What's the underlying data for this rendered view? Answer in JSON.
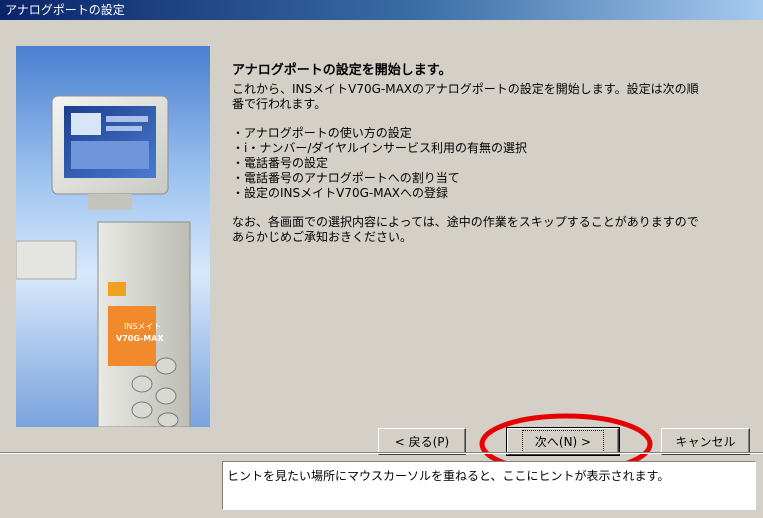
{
  "window": {
    "title": "アナログポートの設定"
  },
  "main": {
    "heading": "アナログポートの設定を開始します。",
    "intro_line1": "これから、INSメイトV70G-MAXのアナログポートの設定を開始します。設定は次の順",
    "intro_line2": "番で行われます。",
    "steps": [
      "・アナログポートの使い方の設定",
      "・i・ナンバー/ダイヤルインサービス利用の有無の選択",
      "・電話番号の設定",
      "・電話番号のアナログポートへの割り当て",
      "・設定のINSメイトV70G-MAXへの登録"
    ],
    "note_line1": "なお、各画面での選択内容によっては、途中の作業をスキップすることがありますので",
    "note_line2": "あらかじめご承知おきください。"
  },
  "illustration": {
    "device_label_line1": "INSメイト",
    "device_label_line2": "V70G-MAX"
  },
  "buttons": {
    "back": "< 戻る(P)",
    "next": "次へ(N) >",
    "cancel": "キャンセル"
  },
  "hint": {
    "text": "ヒントを見たい場所にマウスカーソルを重ねると、ここにヒントが表示されます。"
  },
  "colors": {
    "annotation": "#e60000",
    "title_bar": "#0a246a"
  }
}
